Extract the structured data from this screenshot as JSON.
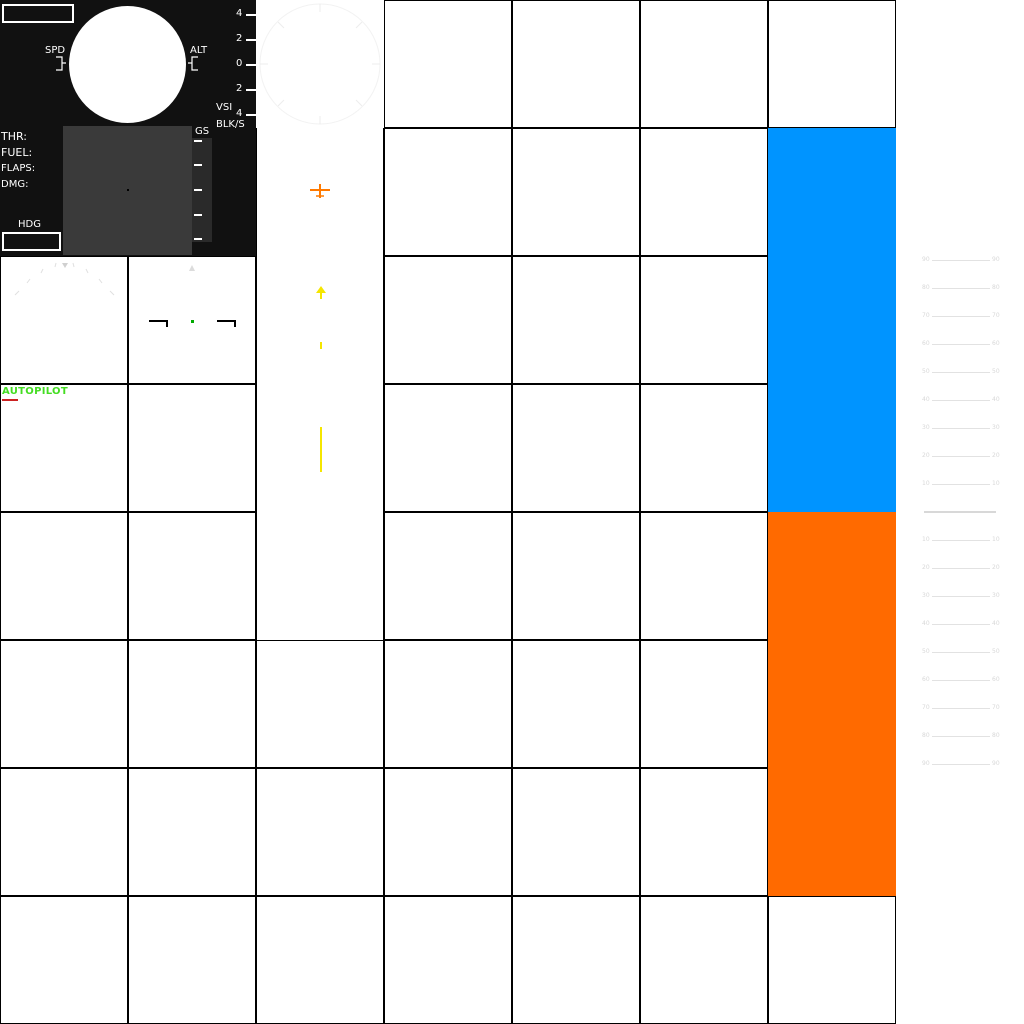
{
  "hud": {
    "labels": {
      "spd": "SPD",
      "alt": "ALT",
      "vsi": "VSI",
      "vsi_unit": "BLK/S",
      "gs": "GS",
      "hdg": "HDG",
      "thr": "THR:",
      "fuel": "FUEL:",
      "flaps": "FLAPS:",
      "dmg": "DMG:"
    },
    "vsi_scale": [
      "4",
      "2",
      "0",
      "2",
      "4"
    ]
  },
  "autopilot": {
    "label": "AUTOPILOT"
  },
  "colors": {
    "panel_bg": "#111111",
    "autopilot_green": "#44dd22",
    "autopilot_red": "#cc2222",
    "sky_blue": "#0094ff",
    "ground_orange": "#ff6a00",
    "marker_orange": "#ff7a00",
    "marker_yellow": "#f5e600",
    "reticle_green": "#00aa00"
  },
  "pitch_ladder": {
    "upper": [
      "90",
      "80",
      "70",
      "60",
      "50",
      "40",
      "30",
      "20",
      "10"
    ],
    "lower": [
      "10",
      "20",
      "30",
      "40",
      "50",
      "60",
      "70",
      "80",
      "90"
    ]
  }
}
